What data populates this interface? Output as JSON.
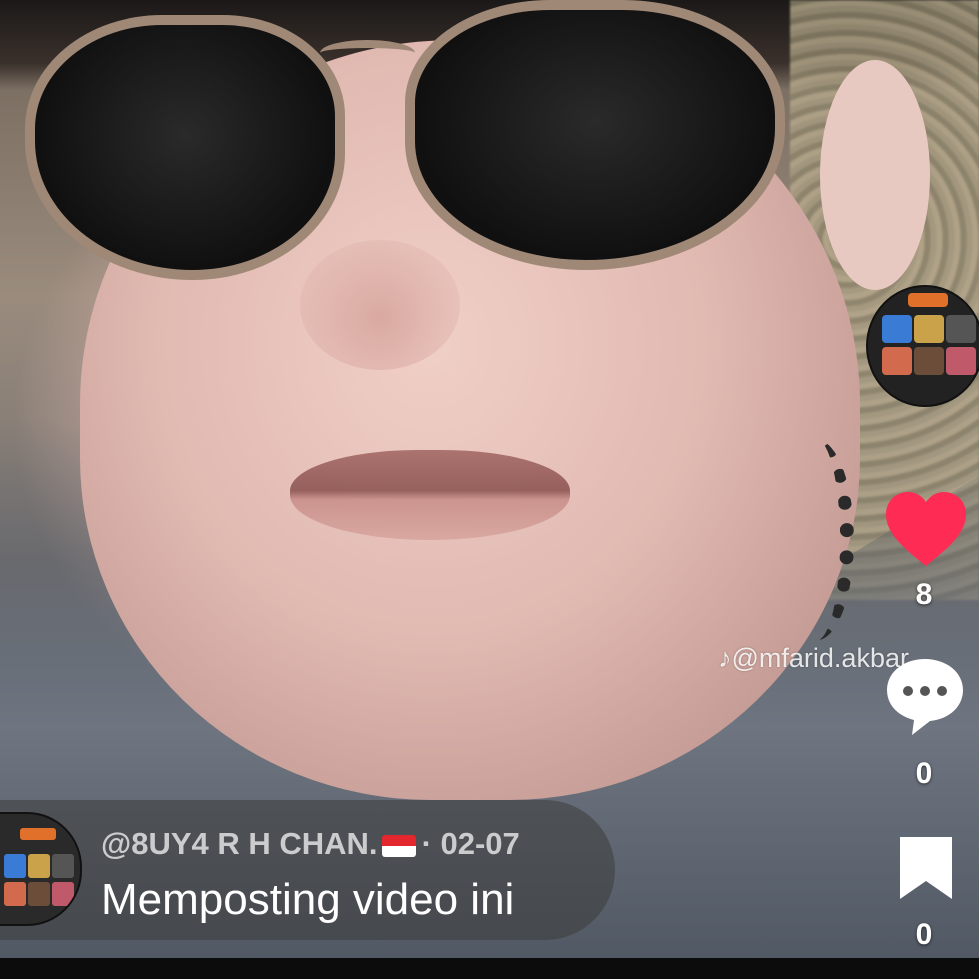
{
  "video": {
    "watermark_text": "♪@mfarid.akbar"
  },
  "actions": {
    "like_count": "8",
    "comment_count": "0",
    "save_count": "0",
    "like_color": "#fe2c55"
  },
  "caption": {
    "username": "@8UY4 R H CHAN.",
    "flag_icon": "indonesia-flag-icon",
    "date": "· 02-07",
    "text": "Memposting video ini"
  }
}
